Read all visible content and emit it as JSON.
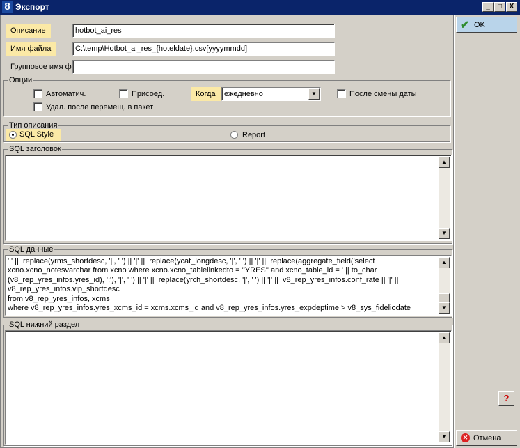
{
  "window": {
    "title": "Экспорт",
    "logo": "8",
    "controls": [
      "_",
      "□",
      "X"
    ]
  },
  "fields": {
    "description": {
      "label": "Описание",
      "value": "hotbot_ai_res"
    },
    "filename": {
      "label": "Имя файла",
      "value": "C:\\temp\\Hotbot_ai_res_{hoteldate}.csv[yyyymmdd]"
    },
    "group_filename": {
      "label": "Групповое имя фа",
      "value": ""
    }
  },
  "options": {
    "caption": "Опции",
    "auto": {
      "label": "Автоматич.",
      "checked": false
    },
    "attach": {
      "label": "Присоед.",
      "checked": false
    },
    "when_label": "Когда",
    "when_value": "ежедневно",
    "after_date_change": {
      "label": "После смены даты",
      "checked": false
    },
    "delete_after": {
      "label": "Удал. после перемещ. в пакет",
      "checked": false
    }
  },
  "description_type": {
    "caption": "Тип описания",
    "sql_style": {
      "label": "SQL Style",
      "selected": true
    },
    "report": {
      "label": "Report",
      "selected": false
    }
  },
  "sql_header": {
    "caption": "SQL заголовок",
    "text": ""
  },
  "sql_data": {
    "caption": "SQL данные",
    "text": "'|' ||  replace(yrms_shortdesc, '|', ' ') || '|' ||  replace(ycat_longdesc, '|', ' ') || '|' ||  replace(aggregate_field('select\nxcno.xcno_notesvarchar from xcno where xcno.xcno_tablelinkedto = ''YRES'' and xcno_table_id = ' || to_char\n(v8_rep_yres_infos.yres_id), ';'), '|', ' ') || '|' ||  replace(yrch_shortdesc, '|', ' ') || '|' ||  v8_rep_yres_infos.conf_rate || '|' ||\nv8_rep_yres_infos.vip_shortdesc\nfrom v8_rep_yres_infos, xcms\nwhere v8_rep_yres_infos.yres_xcms_id = xcms.xcms_id and v8_rep_yres_infos.yres_expdeptime > v8_sys_fideliodate"
  },
  "sql_footer": {
    "caption": "SQL нижний раздел",
    "text": ""
  },
  "buttons": {
    "ok": "OK",
    "cancel": "Отмена",
    "help": "?"
  }
}
